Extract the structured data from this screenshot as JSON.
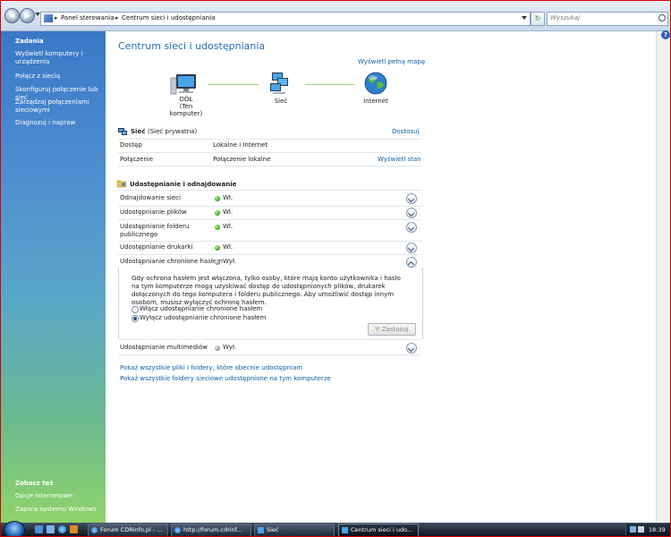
{
  "address_bar": {
    "crumbs": [
      "Panel sterowania",
      "Centrum sieci i udostępniania"
    ],
    "search_placeholder": "Wyszukaj"
  },
  "sidebar": {
    "tasks_heading": "Zadania",
    "tasks": [
      {
        "label": "Wyświetl komputery i urządzenia"
      },
      {
        "label": "Połącz z siecią"
      },
      {
        "label": "Skonfiguruj połączenie lub sieć"
      },
      {
        "label": "Zarządzaj połączeniami sieciowymi"
      },
      {
        "label": "Diagnozuj i napraw"
      }
    ],
    "see_also_heading": "Zobacz też",
    "see_also": [
      {
        "label": "Opcje internetowe"
      },
      {
        "label": "Zapora systemu Windows"
      }
    ]
  },
  "main": {
    "title": "Centrum sieci i udostępniania",
    "full_map_link": "Wyświetl pełną mapę",
    "map": {
      "computer_label": "DÓŁ",
      "computer_sub": "(Ten komputer)",
      "network_label": "Sieć",
      "internet_label": "Internet"
    },
    "network": {
      "name": "Sieć",
      "type": "(Sieć prywatna)",
      "customize_link": "Dostosuj",
      "rows": [
        {
          "label": "Dostęp",
          "value": "Lokalne i Internet",
          "link": ""
        },
        {
          "label": "Połączenie",
          "value": "Połączenie lokalne",
          "link": "Wyświetl stan"
        }
      ]
    },
    "sharing": {
      "heading": "Udostępnianie i odnajdowanie",
      "rows": [
        {
          "label": "Odnajdowanie sieci",
          "status": "Wł."
        },
        {
          "label": "Udostępnianie plików",
          "status": "Wł."
        },
        {
          "label": "Udostępnianie folderu publicznego",
          "status": "Wł."
        },
        {
          "label": "Udostępnianie drukarki",
          "status": "Wł."
        },
        {
          "label": "Udostępnianie chronione hasłem",
          "status": "Wył."
        }
      ],
      "expanded_text": "Gdy ochrona hasłem jest włączona, tylko osoby, które mają konto użytkownika i hasło na tym komputerze mogą uzyskiwać dostęp do udostępnionych plików, drukarek dołączonych do tego komputera i folderu publicznego. Aby umożliwić dostęp innym osobom, musisz wyłączyć ochronę hasłem.",
      "radio_on": "Włącz udostępnianie chronione hasłem",
      "radio_off": "Wyłącz udostępnianie chronione hasłem",
      "apply_button": "Zastosuj",
      "media_label": "Udostępnianie multimediów",
      "media_status": "Wył."
    },
    "bottom_links": [
      "Pokaż wszystkie pliki i foldery, które obecnie udostępniam",
      "Pokaż wszystkie foldery sieciowe udostępnione na tym komputerze"
    ]
  },
  "taskbar": {
    "tasks": [
      {
        "label": "Forum CDRinfo.pl - ..."
      },
      {
        "label": "http://forum.cdrinf..."
      },
      {
        "label": "Sieć"
      },
      {
        "label": "Centrum sieci i udo..."
      }
    ],
    "clock": "18:39"
  },
  "colors": {
    "link": "#0b5fa8",
    "title": "#1f6fb7",
    "status_on": "#2f9e1f"
  }
}
